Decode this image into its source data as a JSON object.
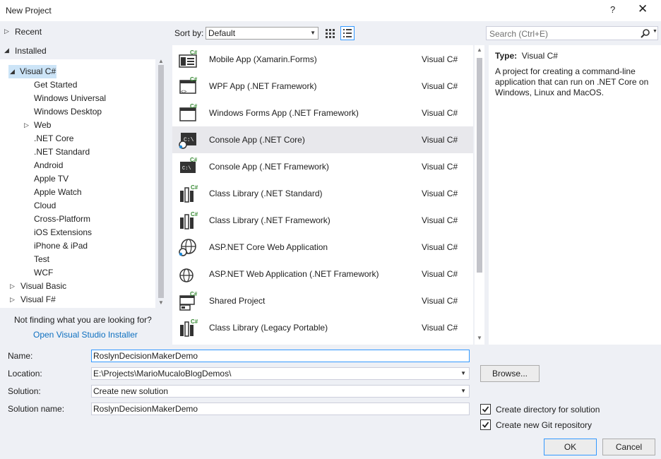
{
  "window": {
    "title": "New Project",
    "help": "?",
    "close": "✕"
  },
  "tree": {
    "recent": "Recent",
    "installed": "Installed",
    "visual_csharp": "Visual C#",
    "children": [
      "Get Started",
      "Windows Universal",
      "Windows Desktop",
      "Web",
      ".NET Core",
      ".NET Standard",
      "Android",
      "Apple TV",
      "Apple Watch",
      "Cloud",
      "Cross-Platform",
      "iOS Extensions",
      "iPhone & iPad",
      "Test",
      "WCF"
    ],
    "visual_basic": "Visual Basic",
    "visual_fsharp": "Visual F#",
    "not_finding": "Not finding what you are looking for?",
    "installer_link": "Open Visual Studio Installer"
  },
  "toolbar": {
    "sort_label": "Sort by:",
    "sort_value": "Default"
  },
  "search": {
    "placeholder": "Search (Ctrl+E)"
  },
  "templates": [
    {
      "name": "Mobile App (Xamarin.Forms)",
      "lang": "Visual C#",
      "icon": "mobile-app-icon"
    },
    {
      "name": "WPF App (.NET Framework)",
      "lang": "Visual C#",
      "icon": "wpf-app-icon"
    },
    {
      "name": "Windows Forms App (.NET Framework)",
      "lang": "Visual C#",
      "icon": "windows-forms-icon"
    },
    {
      "name": "Console App (.NET Core)",
      "lang": "Visual C#",
      "icon": "console-core-icon"
    },
    {
      "name": "Console App (.NET Framework)",
      "lang": "Visual C#",
      "icon": "console-framework-icon"
    },
    {
      "name": "Class Library (.NET Standard)",
      "lang": "Visual C#",
      "icon": "class-library-icon"
    },
    {
      "name": "Class Library (.NET Framework)",
      "lang": "Visual C#",
      "icon": "class-library-icon"
    },
    {
      "name": "ASP.NET Core Web Application",
      "lang": "Visual C#",
      "icon": "aspnet-core-icon"
    },
    {
      "name": "ASP.NET Web Application (.NET Framework)",
      "lang": "Visual C#",
      "icon": "aspnet-web-icon"
    },
    {
      "name": "Shared Project",
      "lang": "Visual C#",
      "icon": "shared-project-icon"
    },
    {
      "name": "Class Library (Legacy Portable)",
      "lang": "Visual C#",
      "icon": "class-library-icon"
    }
  ],
  "detail": {
    "type_label": "Type:",
    "type_value": "Visual C#",
    "description": "A project for creating a command-line application that can run on .NET Core on Windows, Linux and MacOS."
  },
  "form": {
    "name_label": "Name:",
    "name_value": "RoslynDecisionMakerDemo",
    "location_label": "Location:",
    "location_value": "E:\\Projects\\MarioMucaloBlogDemos\\",
    "solution_label": "Solution:",
    "solution_value": "Create new solution",
    "solution_name_label": "Solution name:",
    "solution_name_value": "RoslynDecisionMakerDemo",
    "browse": "Browse...",
    "create_directory": "Create directory for solution",
    "create_git": "Create new Git repository",
    "create_directory_checked": true,
    "create_git_checked": true,
    "ok": "OK",
    "cancel": "Cancel"
  },
  "colors": {
    "accent": "#3399ff",
    "link": "#0e70c0",
    "csharp_green": "#388a34",
    "selection": "#cce4f7"
  }
}
